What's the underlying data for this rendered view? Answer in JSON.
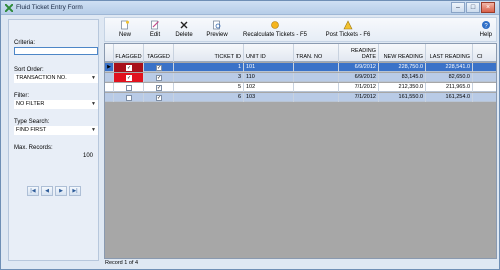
{
  "window": {
    "title": "Fluid Ticket Entry Form"
  },
  "criteria": {
    "label": "Criteria:",
    "value": ""
  },
  "sort_order": {
    "label": "Sort Order:",
    "value": "TRANSACTION NO."
  },
  "filter": {
    "label": "Filter:",
    "value": "NO FILTER"
  },
  "type_search": {
    "label": "Type Search:",
    "value": "FIND FIRST"
  },
  "max_records": {
    "label": "Max. Records:",
    "value": "100"
  },
  "toolbar": {
    "new": "New",
    "edit": "Edit",
    "delete": "Delete",
    "preview": "Preview",
    "recalc": "Recalculate Tickets - F5",
    "post": "Post Tickets - F6",
    "help": "Help"
  },
  "grid": {
    "headers": [
      "FLAGGED",
      "TAGGED",
      "TICKET ID",
      "UNIT ID",
      "TRAN. NO",
      "READING DATE",
      "NEW READING",
      "LAST READING",
      "CI"
    ],
    "rows": [
      {
        "ticket_id": "1",
        "unit_id": "101",
        "tran_no": "",
        "date": "6/9/2012",
        "new_reading": "228,750.0",
        "last_reading": "228,541.0",
        "flagged": true,
        "tagged": true,
        "selected": true
      },
      {
        "ticket_id": "3",
        "unit_id": "110",
        "tran_no": "",
        "date": "6/9/2012",
        "new_reading": "83,145.0",
        "last_reading": "82,650.0",
        "flagged": true,
        "tagged": true,
        "selected": false
      },
      {
        "ticket_id": "5",
        "unit_id": "102",
        "tran_no": "",
        "date": "7/1/2012",
        "new_reading": "212,350.0",
        "last_reading": "211,965.0",
        "flagged": false,
        "tagged": true,
        "selected": false
      },
      {
        "ticket_id": "6",
        "unit_id": "103",
        "tran_no": "",
        "date": "7/1/2012",
        "new_reading": "161,550.0",
        "last_reading": "161,254.0",
        "flagged": false,
        "tagged": true,
        "selected": false
      }
    ]
  },
  "status": {
    "text": "Record 1 of 4"
  },
  "colors": {
    "selected_row": "#3a72c8",
    "flag_red": "#e1121e",
    "flag_dark": "#a8101a",
    "alt_row": "#b9cbe6"
  }
}
